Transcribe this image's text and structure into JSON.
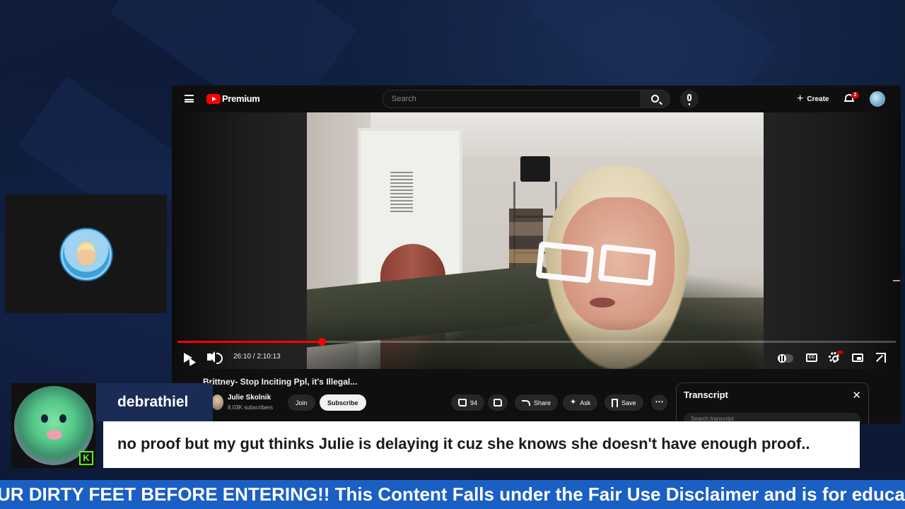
{
  "youtube": {
    "brand": "Premium",
    "search": {
      "placeholder": "Search"
    },
    "create_label": "Create",
    "notification_count": "2",
    "video": {
      "title": "Brittney- Stop Inciting Ppl, it's Illegal...",
      "current_time": "26:10",
      "duration": "2:10:13",
      "time_display": "26:10 / 2:10:13",
      "progress_fraction": 0.201
    },
    "channel": {
      "name": "Julie Skolnik",
      "subscribers": "8.03K subscribers",
      "join_label": "Join",
      "subscribe_label": "Subscribe"
    },
    "actions": {
      "like_count": "94",
      "share_label": "Share",
      "ask_label": "Ask",
      "save_label": "Save"
    },
    "transcript": {
      "title": "Transcript",
      "search_placeholder": "Search transcript"
    },
    "icons": [
      "menu-icon",
      "youtube-logo-icon",
      "search-icon",
      "mic-icon",
      "plus-icon",
      "bell-icon",
      "play-icon",
      "volume-icon",
      "autoplay-toggle-icon",
      "captions-icon",
      "settings-icon",
      "miniplayer-icon",
      "fullscreen-icon",
      "like-icon",
      "dislike-icon",
      "share-icon",
      "ask-sparkle-icon",
      "save-icon",
      "more-icon",
      "close-icon"
    ]
  },
  "chat": {
    "username": "debrathiel",
    "message": "no proof but my gut thinks Julie is delaying it cuz she knows she doesn't have enough proof..",
    "platform_badge": "K",
    "accent_color": "#53fc18"
  },
  "ticker": {
    "text": "UR DIRTY FEET BEFORE ENTERING!! This Content Falls under the Fair Use Disclaimer and is for educationa",
    "color": "#1a5fc4"
  },
  "colors": {
    "youtube_red": "#ff0000",
    "name_box": "#1a2c55",
    "background": "#0e1a33"
  }
}
